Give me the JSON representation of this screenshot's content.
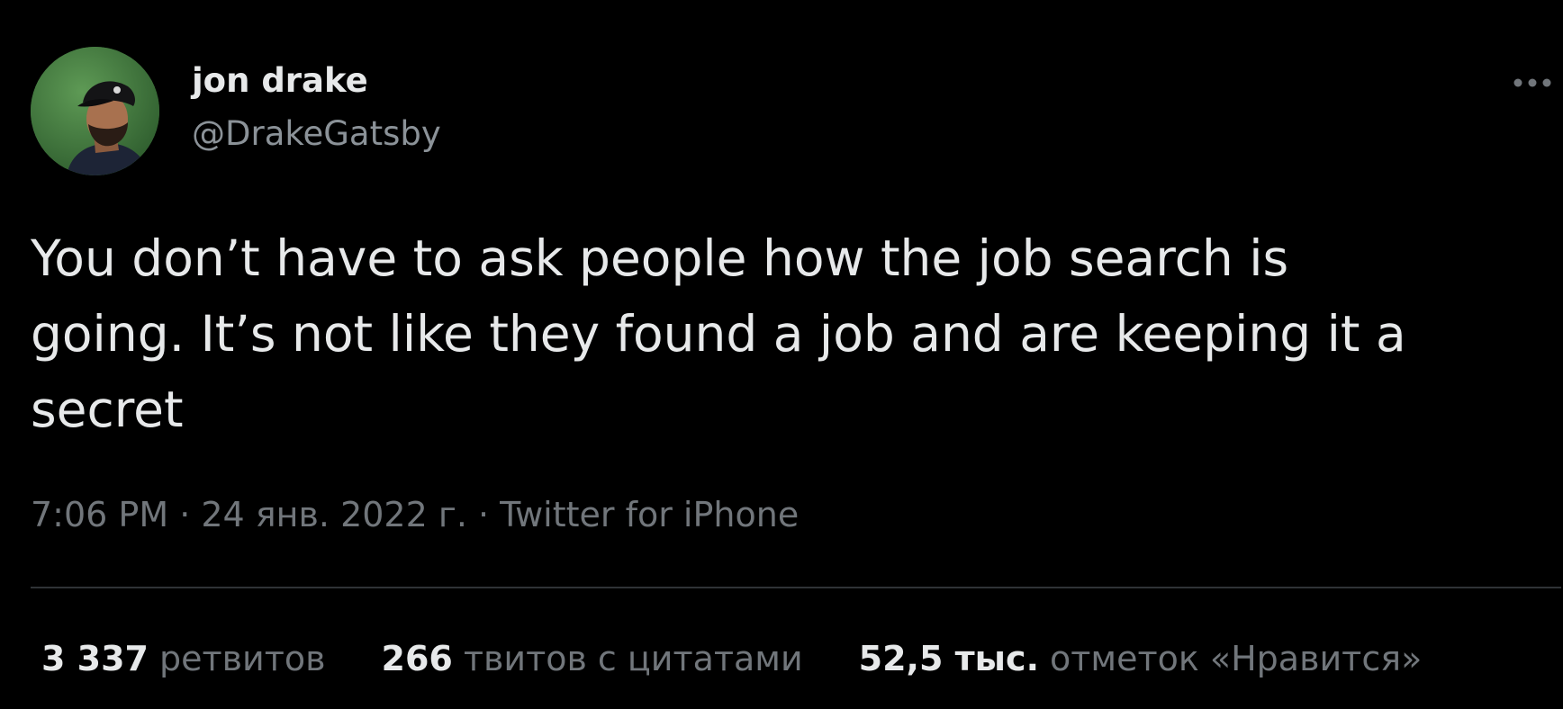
{
  "author": {
    "display_name": "jon drake",
    "handle": "@DrakeGatsby",
    "avatar_icon": "profile-photo"
  },
  "more_icon": "more-dots-icon",
  "tweet": {
    "text": "You don’t have to ask people how the job search is\ngoing. It’s not like they found a job and are keeping it a\nsecret"
  },
  "meta": {
    "time": "7:06 PM",
    "separator1": " · ",
    "date": "24 янв. 2022 г.",
    "separator2": " · ",
    "source": "Twitter for iPhone"
  },
  "stats": {
    "retweets_count": "3 337",
    "retweets_label": "ретвитов",
    "quotes_count": "266",
    "quotes_label": "твитов с цитатами",
    "likes_count": "52,5 тыс.",
    "likes_label": "отметок «Нравится»"
  },
  "colors": {
    "background": "#000000",
    "text_primary": "#e7e9ea",
    "text_secondary": "#71767b",
    "divider": "#2f3336"
  }
}
